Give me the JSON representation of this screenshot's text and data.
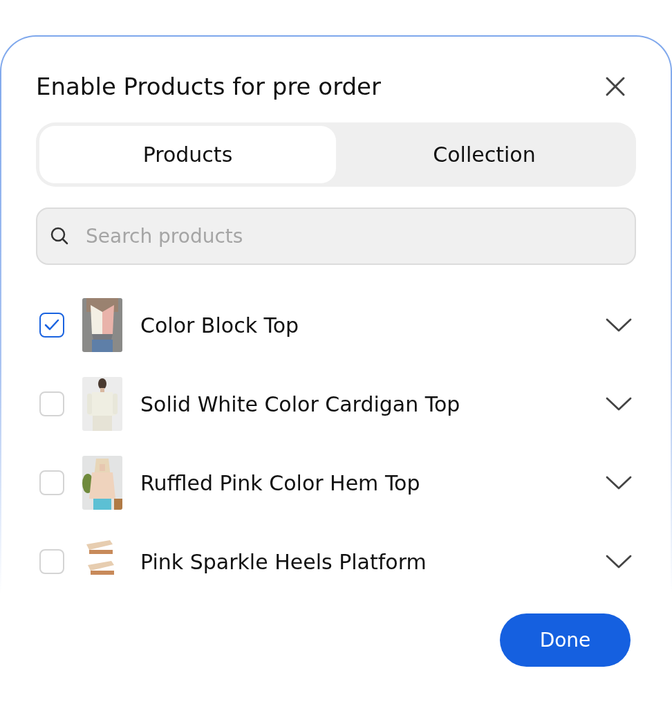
{
  "dialog": {
    "title": "Enable Products for pre order"
  },
  "tabs": [
    {
      "label": "Products",
      "selected": true
    },
    {
      "label": "Collection",
      "selected": false
    }
  ],
  "search": {
    "placeholder": "Search products"
  },
  "products": [
    {
      "name": "Color Block Top",
      "checked": true
    },
    {
      "name": "Solid White Color Cardigan Top",
      "checked": false
    },
    {
      "name": "Ruffled Pink Color Hem Top",
      "checked": false
    },
    {
      "name": "Pink Sparkle Heels Platform",
      "checked": false
    }
  ],
  "done_button": "Done"
}
